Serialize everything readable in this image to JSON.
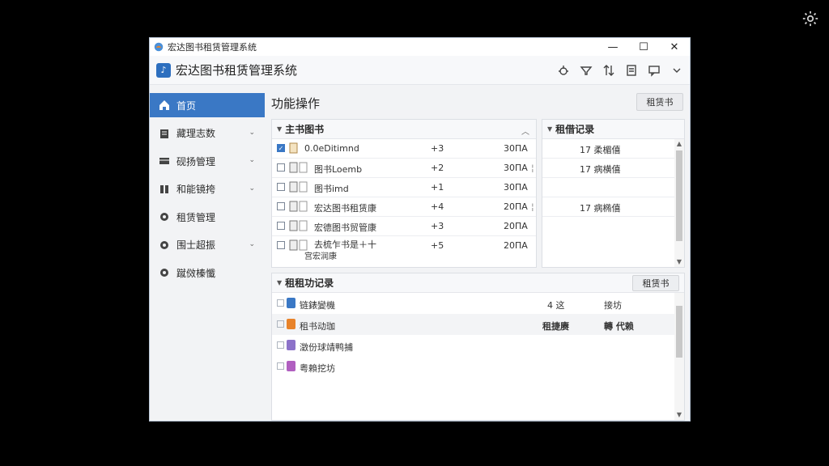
{
  "window": {
    "title": "宏达图书租赁管理系统",
    "controls": {
      "minimize": "—",
      "maximize": "☐",
      "close": "✕"
    }
  },
  "header": {
    "app_name": "宏达图书租赁管理系统",
    "logo_glyph": "♪"
  },
  "sidebar": {
    "items": [
      {
        "label": "首页",
        "icon": "home-icon",
        "active": true,
        "has_chevron": false
      },
      {
        "label": "藏理志数",
        "icon": "clipboard-icon",
        "active": false,
        "has_chevron": true
      },
      {
        "label": "砚扬管理",
        "icon": "card-icon",
        "active": false,
        "has_chevron": true
      },
      {
        "label": "和能镜挎",
        "icon": "book-icon",
        "active": false,
        "has_chevron": true
      },
      {
        "label": "租赁管理",
        "icon": "gear-icon",
        "active": false,
        "has_chevron": false
      },
      {
        "label": "围士超振",
        "icon": "gear-icon",
        "active": false,
        "has_chevron": true
      },
      {
        "label": "蹴傚榛懺",
        "icon": "gear-icon",
        "active": false,
        "has_chevron": false
      }
    ]
  },
  "main": {
    "title": "功能操作",
    "rent_button": "租赁书"
  },
  "books_panel": {
    "title": "主书图书",
    "rows": [
      {
        "name": "0.0eDitimnd",
        "qty": "+3",
        "price": "30ΠA",
        "checked": true
      },
      {
        "name": "图书Loemb",
        "qty": "+2",
        "price": "30ΠA",
        "checked": false,
        "marker": "¦"
      },
      {
        "name": "图书imd",
        "qty": "+1",
        "price": "30ΠA",
        "checked": false
      },
      {
        "name": "宏达图书租赁康",
        "qty": "+4",
        "price": "20ΠA",
        "checked": false,
        "marker": "¦"
      },
      {
        "name": "宏德图书贸管康",
        "qty": "+3",
        "price": "20ΠA",
        "checked": false
      },
      {
        "name": "去梳乍书是＋十",
        "name2": "宫宏润康",
        "qty": "+5",
        "price": "20ΠA",
        "checked": false
      }
    ]
  },
  "records_panel": {
    "title": "租借记录",
    "rows": [
      {
        "text": "17 柔楣僖"
      },
      {
        "text": "17 病横僖"
      },
      {
        "text": ""
      },
      {
        "text": "17 病椭僖"
      }
    ]
  },
  "activity_panel": {
    "title": "租租功记录",
    "button": "租赁书",
    "rows": [
      {
        "label": "链錶變機",
        "col2": "4 这",
        "col3": "接坊",
        "icon_color": "#3a78c5",
        "highlight": false
      },
      {
        "label": "租书动珈",
        "col2": "租捷赓",
        "col3": "轉 代赖",
        "icon_color": "#e8832a",
        "highlight": true
      },
      {
        "label": "澂份球靖鸭捕",
        "col2": "",
        "col3": "",
        "icon_color": "#8c72c9",
        "highlight": false
      },
      {
        "label": "粤賴挖坊",
        "col2": "",
        "col3": "",
        "icon_color": "#b05fc0",
        "highlight": false
      }
    ]
  }
}
